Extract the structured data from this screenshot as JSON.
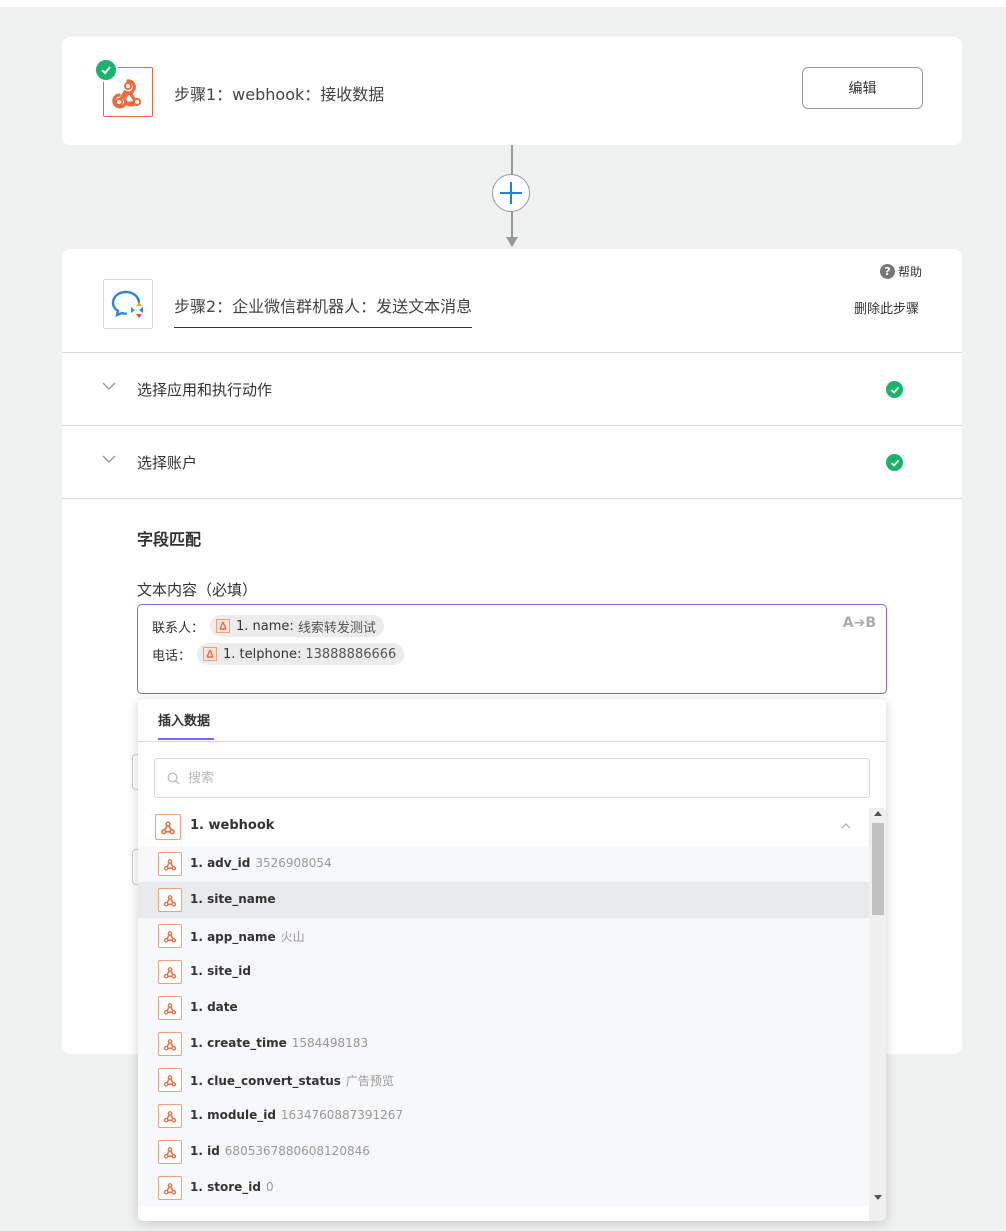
{
  "step1": {
    "title": "步骤1：webhook：接收数据",
    "edit_label": "编辑",
    "icon": "webhook-icon",
    "status": "completed"
  },
  "connector": {
    "add_icon": "plus-icon"
  },
  "step2": {
    "title": "步骤2：企业微信群机器人：发送文本消息",
    "icon": "wecom-robot-icon",
    "help_label": "帮助",
    "delete_label": "删除此步骤",
    "sections": [
      {
        "label": "选择应用和执行动作",
        "status": "completed"
      },
      {
        "label": "选择账户",
        "status": "completed"
      }
    ],
    "field_mapping": {
      "title": "字段匹配",
      "field_label": "文本内容（必填）",
      "lines": [
        {
          "prefix": "联系人：",
          "chip_key": "1. name:",
          "chip_value": "线索转发测试"
        },
        {
          "prefix": "电话：",
          "chip_key": "1. telphone:",
          "chip_value": "13888886666"
        }
      ],
      "transform_label": "A➔B"
    }
  },
  "dropdown": {
    "tab_label": "插入数据",
    "search_placeholder": "搜索",
    "group_name": "1. webhook",
    "items": [
      {
        "key": "1. adv_id",
        "value": "3526908054"
      },
      {
        "key": "1. site_name",
        "value": ""
      },
      {
        "key": "1. app_name",
        "value": "火山"
      },
      {
        "key": "1. site_id",
        "value": ""
      },
      {
        "key": "1. date",
        "value": ""
      },
      {
        "key": "1. create_time",
        "value": "1584498183"
      },
      {
        "key": "1. clue_convert_status",
        "value": "广告预览"
      },
      {
        "key": "1. module_id",
        "value": "1634760887391267"
      },
      {
        "key": "1. id",
        "value": "6805367880608120846"
      },
      {
        "key": "1. store_id",
        "value": "0"
      }
    ],
    "highlighted_index": 1
  },
  "colors": {
    "accent": "#7b68ee",
    "success": "#1ab36c",
    "webhook_orange": "#ec6b3d",
    "background": "#f0f2f2"
  }
}
